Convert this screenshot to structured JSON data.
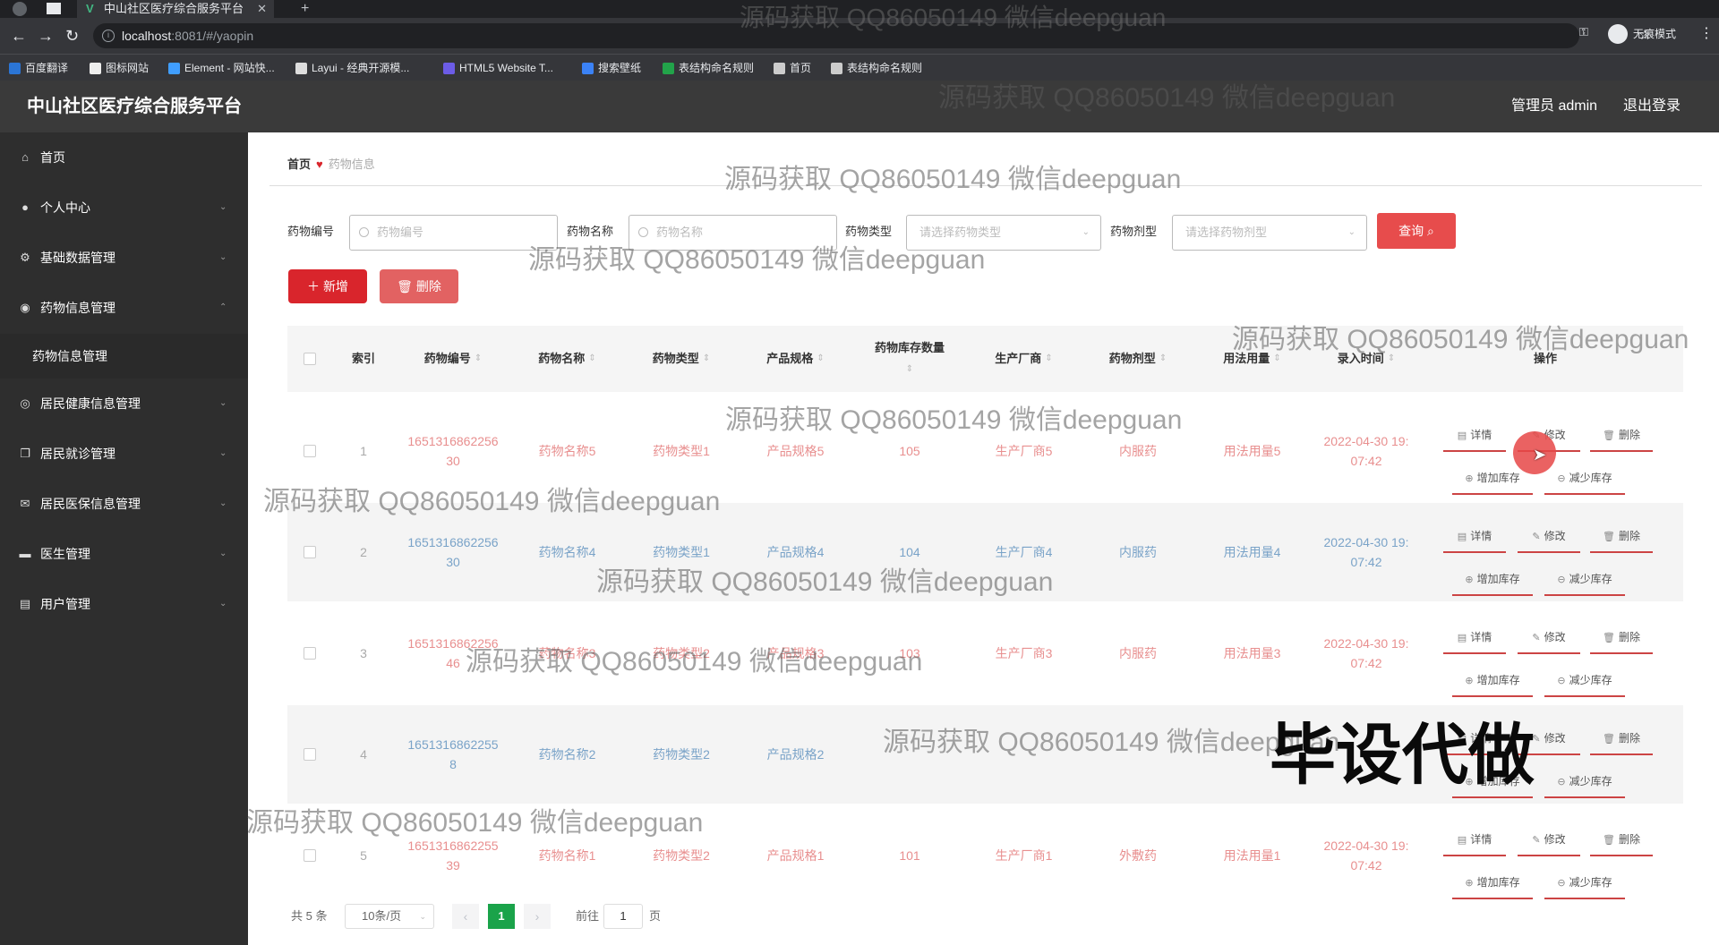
{
  "browser": {
    "tab_title": "中山社区医疗综合服务平台",
    "url_host": "localhost",
    "url_path": ":8081/#/yaopin",
    "profile_label": "无痕模式",
    "bookmarks": [
      {
        "label": "百度翻译",
        "color": "#2b75d6"
      },
      {
        "label": "图标网站",
        "color": "#eeeeee"
      },
      {
        "label": "Element - 网站快...",
        "color": "#409eff"
      },
      {
        "label": "Layui - 经典开源模...",
        "color": "#dddddd"
      },
      {
        "label": "HTML5 Website T...",
        "color": "#6c5ce7"
      },
      {
        "label": "搜索壁纸",
        "color": "#3b82f6"
      },
      {
        "label": "表结构命名规则",
        "color": "#22a34a"
      },
      {
        "label": "首页",
        "color": "#cccccc"
      },
      {
        "label": "表结构命名规则",
        "color": "#cccccc"
      }
    ]
  },
  "header": {
    "title": "中山社区医疗综合服务平台",
    "admin": "管理员 admin",
    "logout": "退出登录"
  },
  "sidebar": {
    "items": [
      {
        "label": "首页",
        "icon": "home-icon"
      },
      {
        "label": "个人中心",
        "icon": "user-icon"
      },
      {
        "label": "基础数据管理",
        "icon": "settings-icon"
      },
      {
        "label": "药物信息管理",
        "icon": "pill-icon"
      },
      {
        "label": "药物信息管理",
        "icon": ""
      },
      {
        "label": "居民健康信息管理",
        "icon": "compass-icon"
      },
      {
        "label": "居民就诊管理",
        "icon": "copy-icon"
      },
      {
        "label": "居民医保信息管理",
        "icon": "mail-icon"
      },
      {
        "label": "医生管理",
        "icon": "doctor-icon"
      },
      {
        "label": "用户管理",
        "icon": "users-icon"
      }
    ]
  },
  "breadcrumb": {
    "home": "首页",
    "current": "药物信息"
  },
  "filters": {
    "code_label": "药物编号",
    "code_placeholder": "药物编号",
    "name_label": "药物名称",
    "name_placeholder": "药物名称",
    "type_label": "药物类型",
    "type_placeholder": "请选择药物类型",
    "form_label": "药物剂型",
    "form_placeholder": "请选择药物剂型",
    "query": "查询"
  },
  "actions": {
    "add": "新增",
    "delete": "删除"
  },
  "table": {
    "headers": [
      "索引",
      "药物编号",
      "药物名称",
      "药物类型",
      "产品规格",
      "药物库存数量",
      "生产厂商",
      "药物剂型",
      "用法用量",
      "录入时间",
      "操作"
    ],
    "row_actions": {
      "detail": "详情",
      "edit": "修改",
      "delete": "删除",
      "stock_in": "增加库存",
      "stock_out": "减少库存"
    },
    "rows": [
      {
        "index": "1",
        "code": "1651316862256\n30",
        "name": "药物名称5",
        "type": "药物类型1",
        "spec": "产品规格5",
        "stock": "105",
        "maker": "生产厂商5",
        "form": "内服药",
        "usage": "用法用量5",
        "time": "2022-04-30 19:\n07:42"
      },
      {
        "index": "2",
        "code": "1651316862256\n30",
        "name": "药物名称4",
        "type": "药物类型1",
        "spec": "产品规格4",
        "stock": "104",
        "maker": "生产厂商4",
        "form": "内服药",
        "usage": "用法用量4",
        "time": "2022-04-30 19:\n07:42"
      },
      {
        "index": "3",
        "code": "1651316862256\n46",
        "name": "药物名称3",
        "type": "药物类型2",
        "spec": "产品规格3",
        "stock": "103",
        "maker": "生产厂商3",
        "form": "内服药",
        "usage": "用法用量3",
        "time": "2022-04-30 19:\n07:42"
      },
      {
        "index": "4",
        "code": "1651316862255\n8",
        "name": "药物名称2",
        "type": "药物类型2",
        "spec": "产品规格2",
        "stock": "",
        "maker": "",
        "form": "",
        "usage": "",
        "time": ""
      },
      {
        "index": "5",
        "code": "1651316862255\n39",
        "name": "药物名称1",
        "type": "药物类型2",
        "spec": "产品规格1",
        "stock": "101",
        "maker": "生产厂商1",
        "form": "外敷药",
        "usage": "用法用量1",
        "time": "2022-04-30 19:\n07:42"
      }
    ]
  },
  "pagination": {
    "total": "共 5 条",
    "page_size": "10条/页",
    "current": "1",
    "goto": "前往",
    "goto_value": "1",
    "page_unit": "页"
  },
  "overlays": {
    "watermark": "源码获取 QQ86050149 微信deepguan",
    "stamp": "毕设代做"
  },
  "colors": {
    "brand_red": "#d9252c",
    "pager_active": "#1aa34a"
  }
}
